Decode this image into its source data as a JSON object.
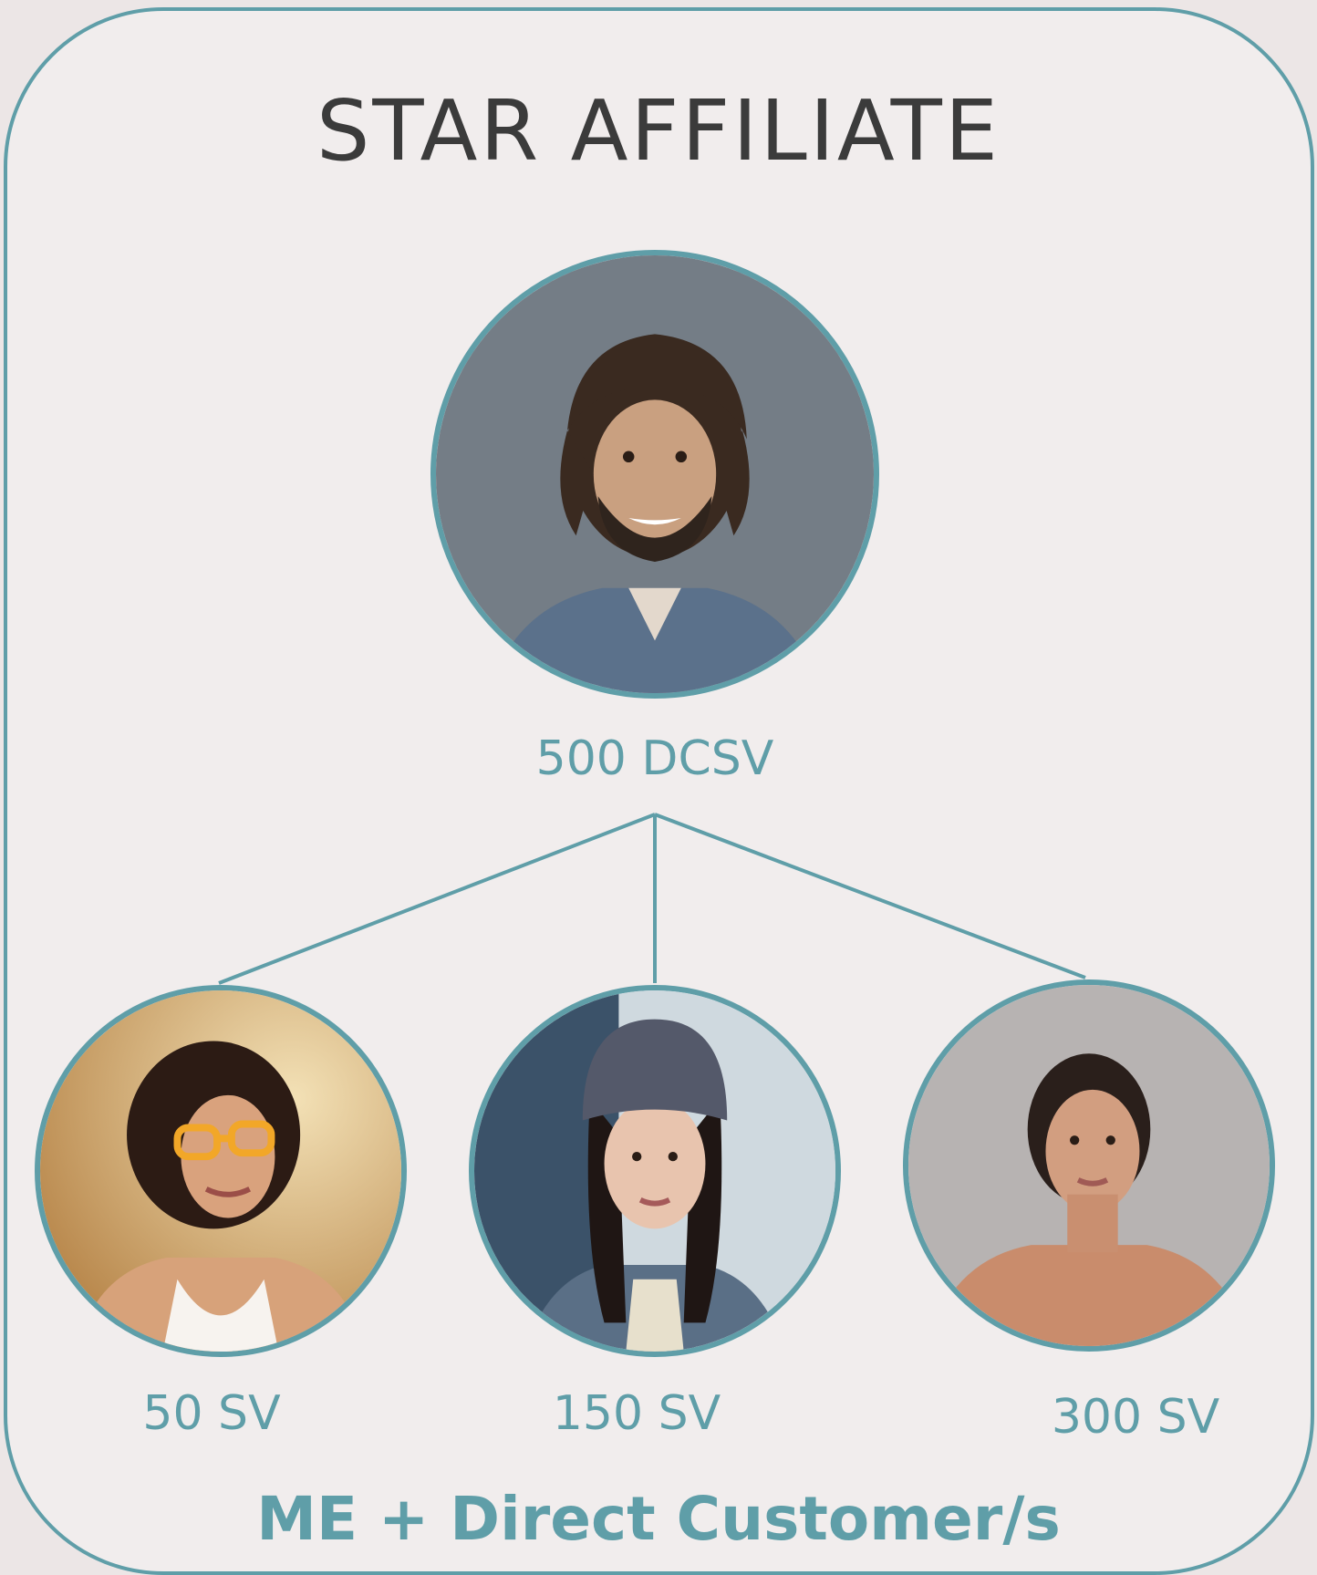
{
  "title": "STAR AFFILIATE",
  "top": {
    "value_label": "500 DCSV",
    "icon": "man-portrait"
  },
  "downline": [
    {
      "value_label": "50 SV",
      "icon": "woman-glasses-portrait"
    },
    {
      "value_label": "150 SV",
      "icon": "woman-beanie-portrait"
    },
    {
      "value_label": "300 SV",
      "icon": "woman-short-hair-portrait"
    }
  ],
  "footer": "ME + Direct Customer/s",
  "colors": {
    "accent": "#5f9ea8",
    "card": "#f1eded",
    "title": "#3b3b3b"
  }
}
